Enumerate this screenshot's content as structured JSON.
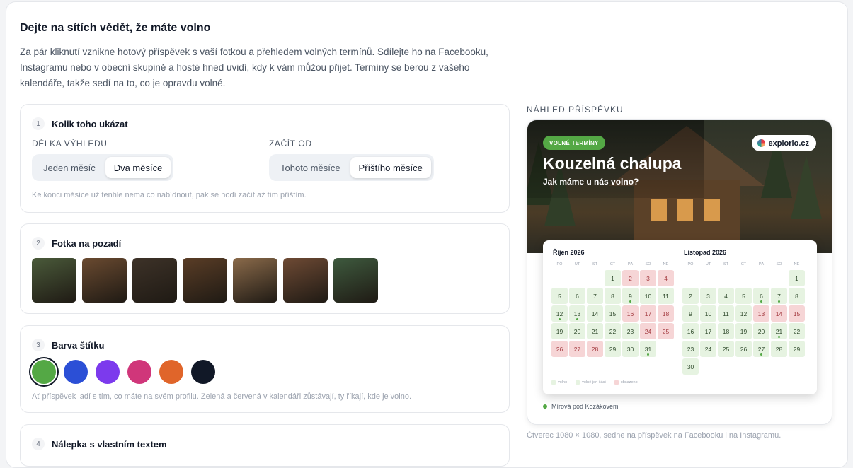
{
  "section": {
    "title": "Dejte na sítích vědět, že máte volno",
    "intro": "Za pár kliknutí vznikne hotový příspěvek s vaší fotkou a přehledem volných termínů. Sdílejte ho na Facebooku, Instagramu nebo v obecní skupině a hosté hned uvidí, kdy k vám můžou přijet. Termíny se berou z vašeho kalendáře, takže sedí na to, co je opravdu volné."
  },
  "step1": {
    "num": "1",
    "label": "Kolik toho ukázat",
    "range_label": "DÉLKA VÝHLEDU",
    "range_options": [
      "Jeden měsíc",
      "Dva měsíce"
    ],
    "range_selected": 1,
    "start_label": "ZAČÍT OD",
    "start_options": [
      "Tohoto měsíce",
      "Příštího měsíce"
    ],
    "start_selected": 1,
    "hint": "Ke konci měsíce už tenhle nemá co nabídnout, pak se hodí začít až tím příštím."
  },
  "step2": {
    "num": "2",
    "label": "Fotka na pozadí",
    "photos": [
      "#4a5a3a",
      "#6a4a30",
      "#3d3228",
      "#5a3d26",
      "#8a6a4a",
      "#6e4a34",
      "#3e5a3e"
    ]
  },
  "step3": {
    "num": "3",
    "label": "Barva štítku",
    "colors": [
      "#54a845",
      "#2b4fd6",
      "#7c3aed",
      "#d0367a",
      "#e0652a",
      "#111827"
    ],
    "selected": 0,
    "hint": "Ať příspěvek ladí s tím, co máte na svém profilu. Zelená a červená v kalendáři zůstávají, ty říkají, kde je volno."
  },
  "step4": {
    "num": "4",
    "label": "Nálepka s vlastním textem"
  },
  "preview": {
    "label": "NÁHLED PŘÍSPĚVKU",
    "badge": "VOLNÉ TERMÍNY",
    "brand": "explorio.cz",
    "post_title": "Kouzelná chalupa",
    "post_subtitle": "Jak máme u nás volno?",
    "weekdays": [
      "PO",
      "ÚT",
      "ST",
      "ČT",
      "PÁ",
      "SO",
      "NE"
    ],
    "months": [
      {
        "name": "Říjen 2026",
        "offset": 3,
        "busy": [
          2,
          3,
          4,
          16,
          17,
          18,
          24,
          25,
          26,
          27,
          28
        ],
        "partial": [
          9,
          12,
          13,
          24,
          28,
          31
        ],
        "days": 31
      },
      {
        "name": "Listopad 2026",
        "offset": 6,
        "busy": [
          13,
          14,
          15
        ],
        "partial": [
          6,
          7,
          21,
          27
        ],
        "days": 30
      }
    ],
    "legend": [
      "volno",
      "volné jen část",
      "obsazeno"
    ],
    "location": "Mírová pod Kozákovem",
    "caption": "Čtverec 1080 × 1080, sedne na příspěvek na Facebooku i na Instagramu."
  }
}
